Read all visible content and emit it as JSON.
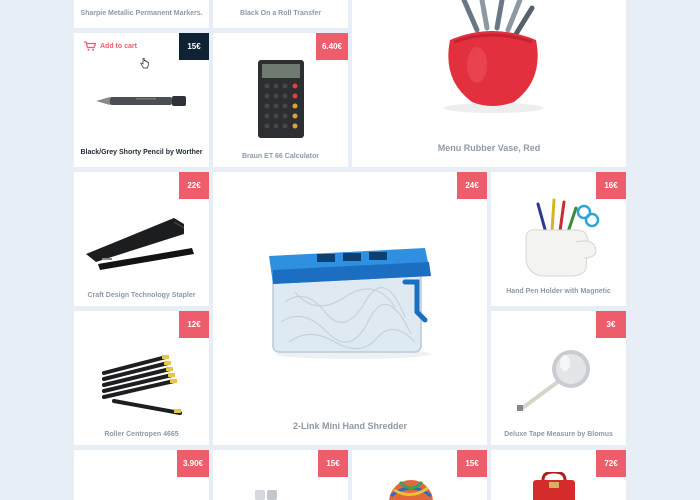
{
  "colors": {
    "background": "#e7eef6",
    "card": "#ffffff",
    "price_badge": "#ee5d6c",
    "price_badge_active": "#0f2335",
    "name_text": "#8f9aa6"
  },
  "products": [
    {
      "name": "Sharpie Metallic Permanent Markers.",
      "price": ""
    },
    {
      "name": "Black On a Roll Transfer",
      "price": ""
    },
    {
      "name": "Menu Rubber Vase, Red",
      "price": ""
    },
    {
      "name": "Black/Grey Shorty Pencil by Worther",
      "price": "15€",
      "add_to_cart": "Add to cart"
    },
    {
      "name": "Braun ET 66 Calculator",
      "price": "6.40€"
    },
    {
      "name": "Craft Design Technology Stapler",
      "price": "22€"
    },
    {
      "name": "2-Link Mini Hand Shredder",
      "price": "24€"
    },
    {
      "name": "Hand Pen Holder with Magnetic",
      "price": "16€"
    },
    {
      "name": "Roller Centropen 4665",
      "price": "12€"
    },
    {
      "name": "Deluxe Tape Measure by Blomus",
      "price": "3€"
    },
    {
      "name": "",
      "price": "3.90€"
    },
    {
      "name": "",
      "price": "15€"
    },
    {
      "name": "",
      "price": "15€"
    },
    {
      "name": "",
      "price": "72€"
    }
  ]
}
